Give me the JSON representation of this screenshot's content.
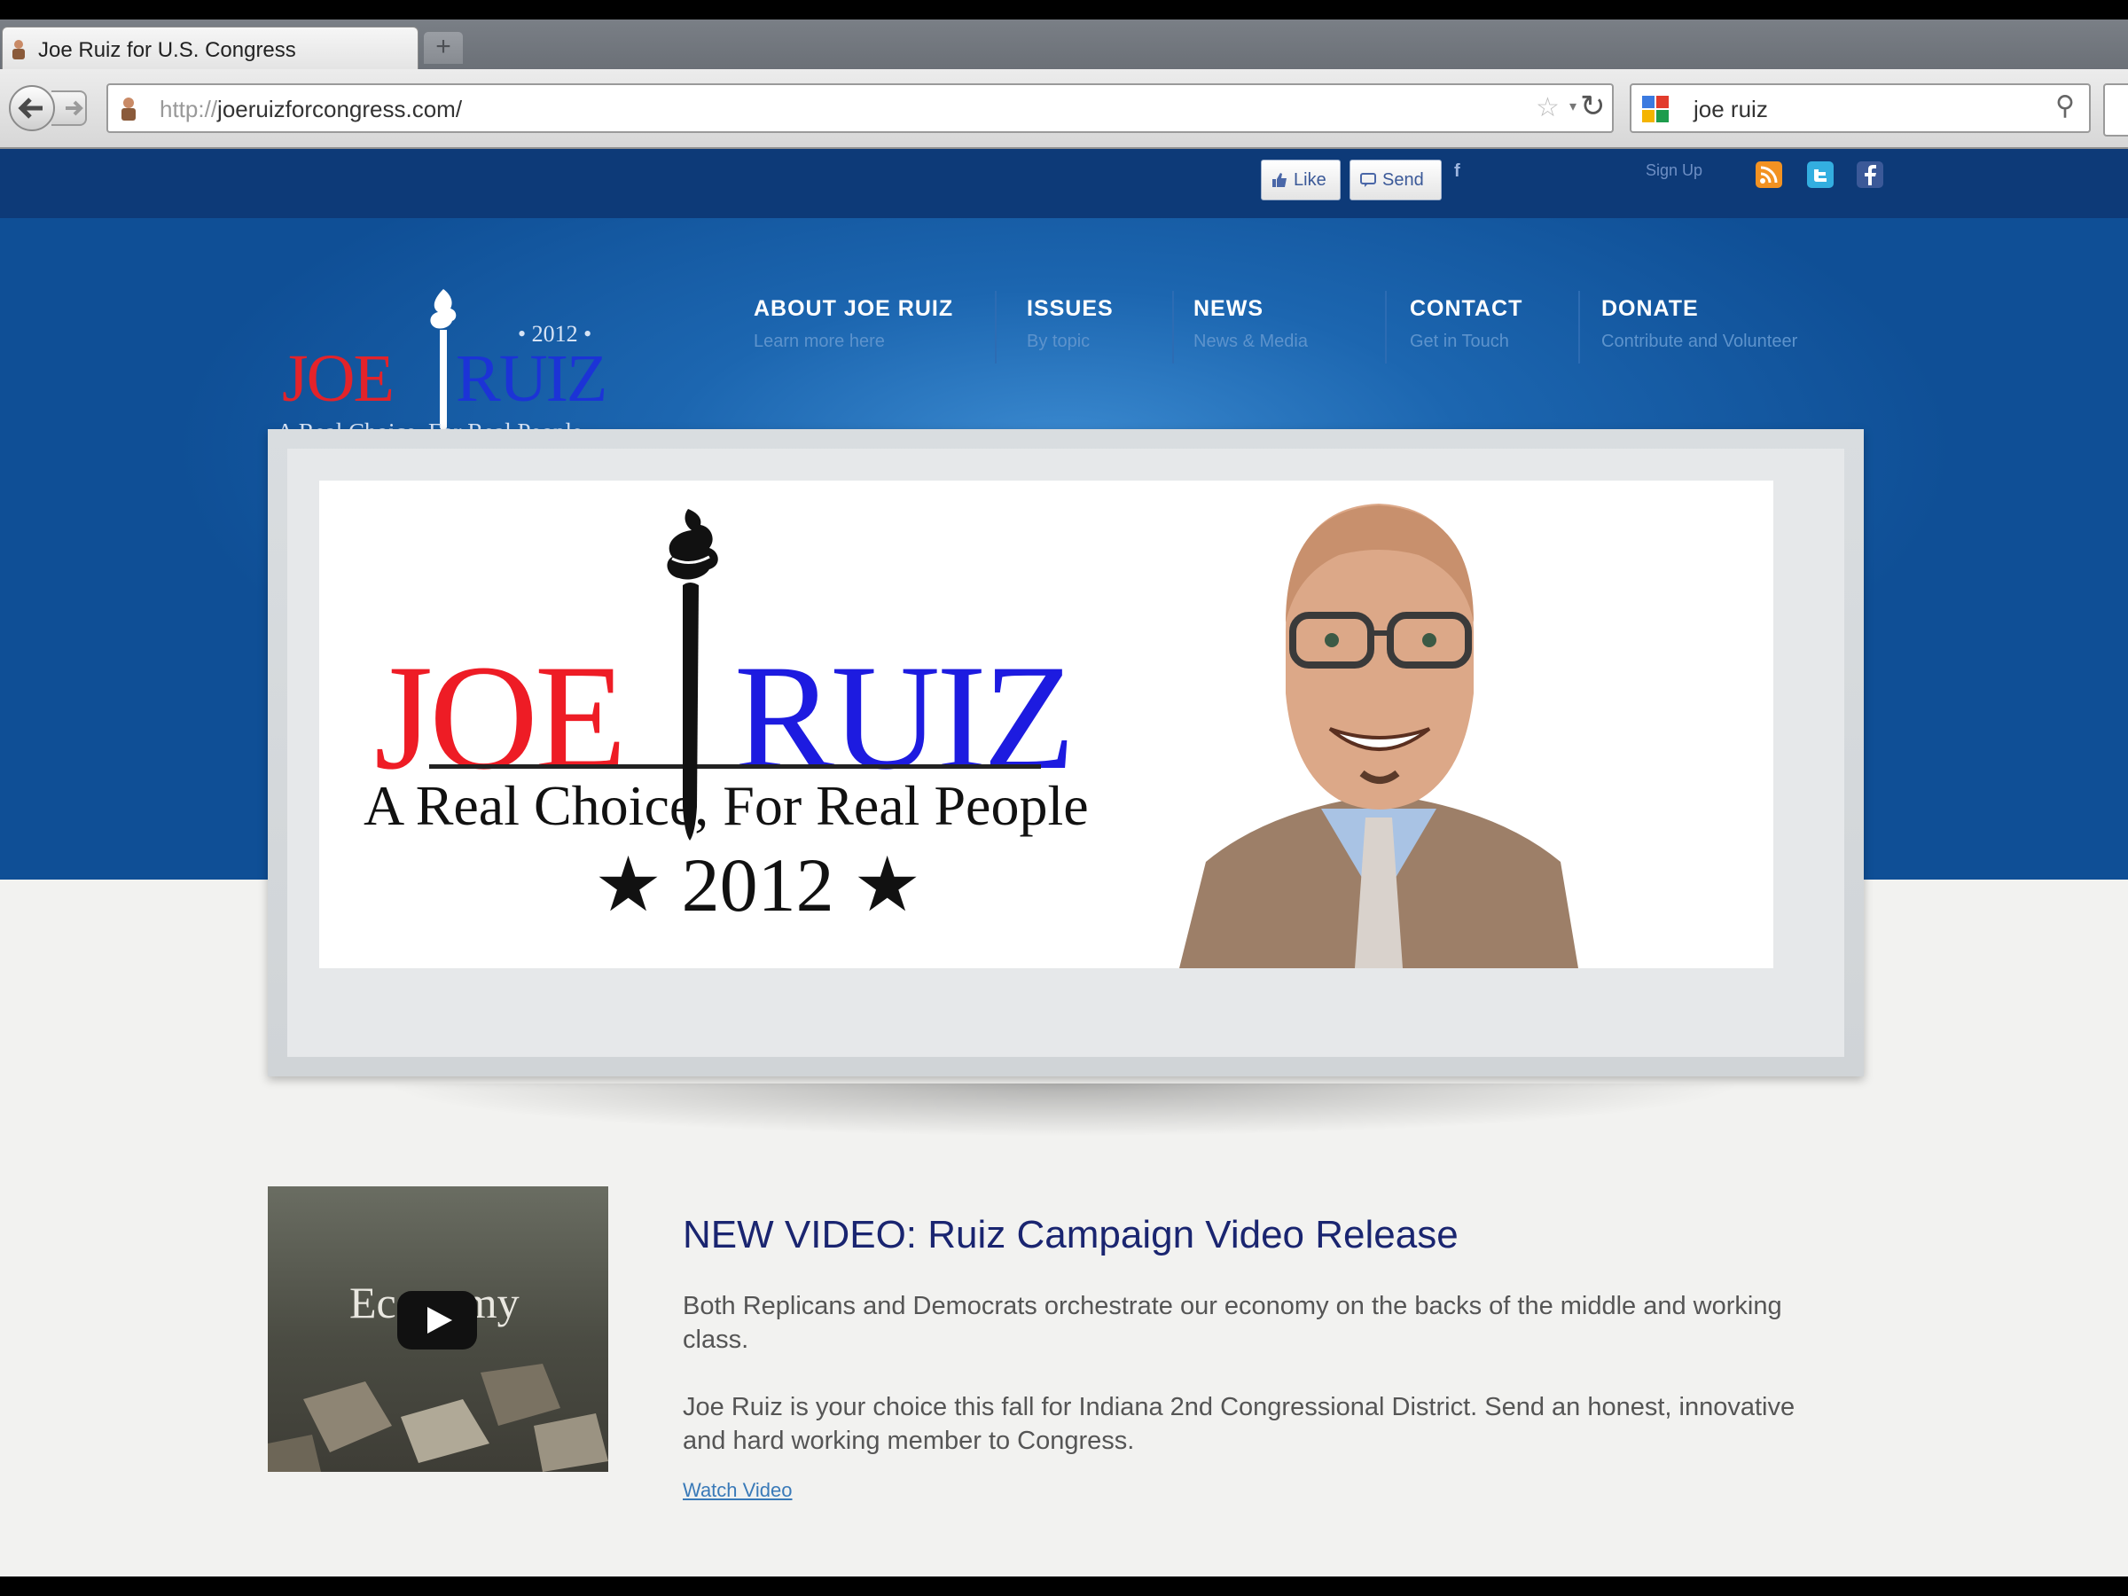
{
  "browser": {
    "tab_title": "Joe Ruiz for U.S. Congress",
    "new_tab_label": "+",
    "url_scheme": "http://",
    "url_host": "joeruizforcongress.com/",
    "search_query": "joe ruiz"
  },
  "social": {
    "like_label": "Like",
    "send_label": "Send",
    "fb_letter": "f",
    "signup_label": "Sign Up"
  },
  "logo": {
    "first": "JOE",
    "last": "RUIZ",
    "year": "• 2012 •",
    "tagline": "A Real Choice, For Real People"
  },
  "nav": [
    {
      "title": "ABOUT JOE RUIZ",
      "sub": "Learn more here"
    },
    {
      "title": "ISSUES",
      "sub": "By topic"
    },
    {
      "title": "NEWS",
      "sub": "News & Media"
    },
    {
      "title": "CONTACT",
      "sub": "Get in Touch"
    },
    {
      "title": "DONATE",
      "sub": "Contribute and Volunteer"
    }
  ],
  "banner": {
    "first": "JOE",
    "last": "RUIZ",
    "tagline": "A Real Choice, For Real People",
    "year": "★ 2012 ★"
  },
  "video": {
    "thumb_text": "Economy",
    "title": "NEW VIDEO:  Ruiz Campaign Video Release",
    "paragraph1": "Both Replicans and Democrats orchestrate our economy on the backs of the middle and working class.",
    "paragraph2": "Joe Ruiz is your choice this fall for Indiana 2nd Congressional District.  Send an honest, innovative and hard working member to Congress.",
    "link_label": "Watch Video"
  },
  "colors": {
    "header_navy": "#0d3a78",
    "hero_blue": "#1c66b0",
    "logo_red": "#e3232a",
    "logo_blue": "#1c33d6",
    "title_navy": "#1a2570",
    "link_blue": "#3a7ab8"
  }
}
